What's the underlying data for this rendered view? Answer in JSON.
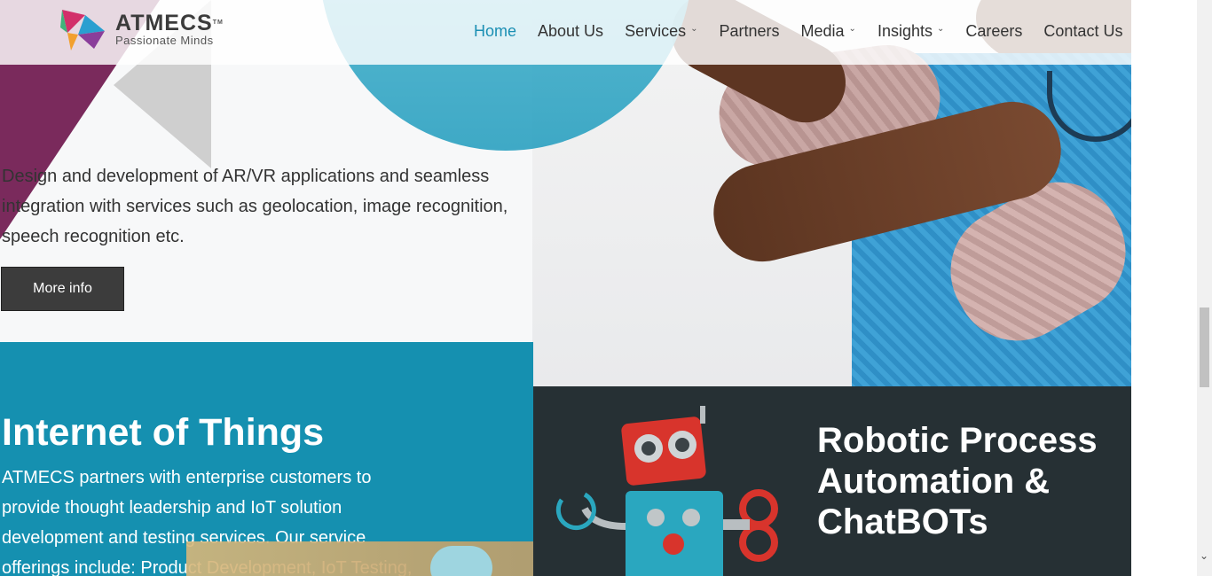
{
  "header": {
    "logo": {
      "name": "ATMECS",
      "tm": "TM",
      "tagline": "Passionate Minds"
    },
    "nav": [
      {
        "label": "Home",
        "active": true,
        "dropdown": false
      },
      {
        "label": "About Us",
        "active": false,
        "dropdown": false
      },
      {
        "label": "Services",
        "active": false,
        "dropdown": true
      },
      {
        "label": "Partners",
        "active": false,
        "dropdown": false
      },
      {
        "label": "Media",
        "active": false,
        "dropdown": true
      },
      {
        "label": "Insights",
        "active": false,
        "dropdown": true
      },
      {
        "label": "Careers",
        "active": false,
        "dropdown": false
      },
      {
        "label": "Contact Us",
        "active": false,
        "dropdown": false
      }
    ]
  },
  "hero": {
    "description": "Design and development of AR/VR applications and seamless integration with services such as geolocation, image recognition, speech recognition etc.",
    "more_button": "More info"
  },
  "iot": {
    "title": "Internet of Things",
    "description": "ATMECS partners with enterprise customers to provide thought leadership and IoT solution development and testing services. Our service offerings include: Product Development, IoT Testing,"
  },
  "rpa": {
    "title": "Robotic Process Automation & ChatBOTs"
  },
  "colors": {
    "accent": "#1a8fb3",
    "iot_bg": "#1590b0",
    "rpa_bg": "#263034",
    "button_bg": "#3c3c3c"
  }
}
